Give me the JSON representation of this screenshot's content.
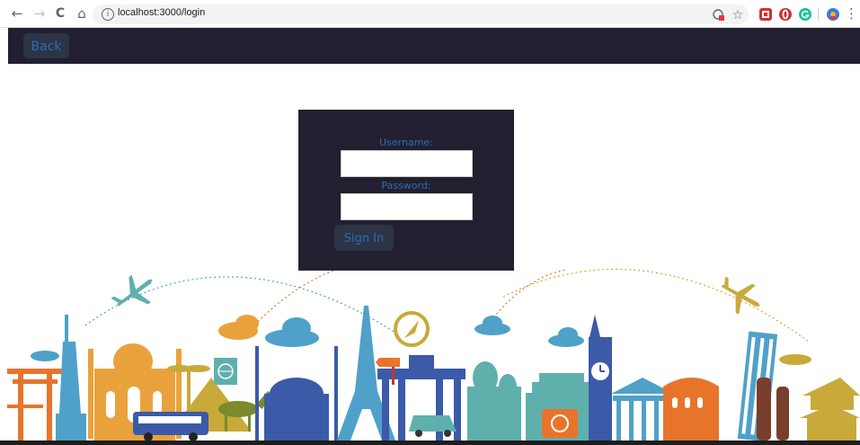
{
  "browser": {
    "back_glyph": "←",
    "forward_glyph": "→",
    "reload_glyph": "C",
    "home_glyph": "⌂",
    "info_glyph": "i",
    "url": "localhost:3000/login",
    "icons": [
      "back-arrow-icon",
      "forward-arrow-icon",
      "reload-icon",
      "home-icon",
      "info-icon",
      "translate-icon",
      "star-icon",
      "extension-icon",
      "opera-icon",
      "grammarly-icon",
      "profile-icon",
      "menu-icon"
    ],
    "star_glyph": "☆",
    "menu_glyph": "⋮"
  },
  "header": {
    "back_label": "Back"
  },
  "login": {
    "username_label": "Username:",
    "username_value": "",
    "password_label": "Password:",
    "password_value": "",
    "signin_label": "Sign In"
  },
  "colors": {
    "header_bg": "#222030",
    "card_bg": "#222030",
    "button_bg": "#2c3446",
    "accent_text": "#2c6db5",
    "skyline_palette": [
      "#e8742c",
      "#4fa1c9",
      "#c8a93a",
      "#3b5aa8",
      "#5fb0ad",
      "#e9a23b",
      "#7a3f2c"
    ]
  },
  "illustration": {
    "icons": [
      "airplane-icon",
      "statue-of-liberty-icon",
      "eiffel-tower-icon",
      "big-ben-icon",
      "leaning-tower-icon",
      "pagoda-icon",
      "compass-icon",
      "bus-icon",
      "car-icon",
      "camera-icon",
      "globe-sign-icon",
      "camel-icon"
    ]
  }
}
